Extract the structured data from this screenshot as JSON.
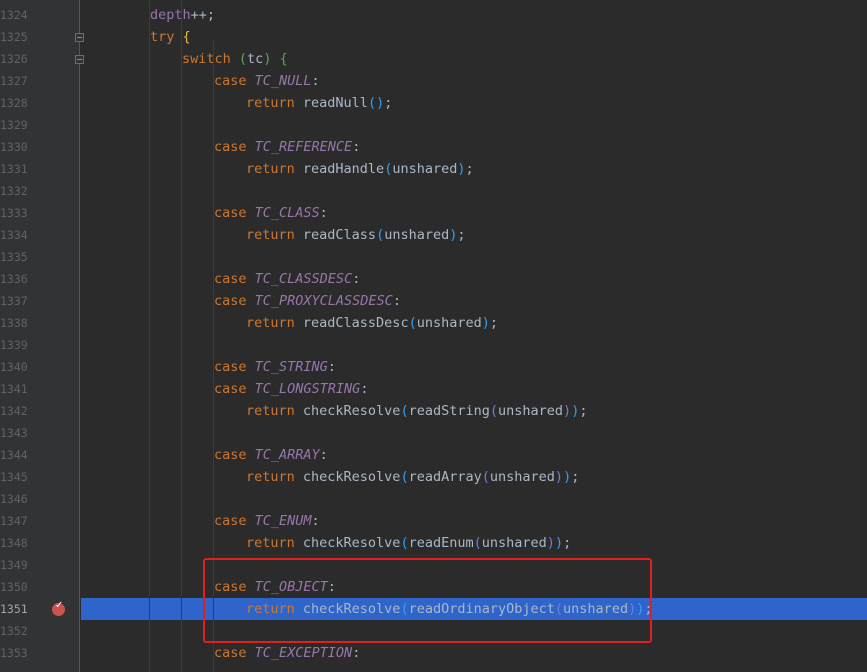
{
  "gutter": {
    "line_numbers": [
      "1324",
      "1325",
      "1326",
      "1327",
      "1328",
      "1329",
      "1330",
      "1331",
      "1332",
      "1333",
      "1334",
      "1335",
      "1336",
      "1337",
      "1338",
      "1339",
      "1340",
      "1341",
      "1342",
      "1343",
      "1344",
      "1345",
      "1346",
      "1347",
      "1348",
      "1349",
      "1350",
      "1351",
      "1352",
      "1353"
    ]
  },
  "editor": {
    "current_line": "1351",
    "lines": [
      [
        [
          "var",
          "depth"
        ],
        [
          "pl",
          "++;"
        ]
      ],
      [
        [
          "kw",
          "try "
        ],
        [
          "p1",
          "{"
        ]
      ],
      [
        [
          "kw",
          "switch "
        ],
        [
          "p2",
          "("
        ],
        [
          "pl",
          "tc"
        ],
        [
          "p2",
          ")"
        ],
        [
          "pl",
          " "
        ],
        [
          "p2",
          "{"
        ]
      ],
      [
        [
          "kw",
          "case "
        ],
        [
          "const",
          "TC_NULL"
        ],
        [
          "pl",
          ":"
        ]
      ],
      [
        [
          "kw",
          "return "
        ],
        [
          "pl",
          "readNull"
        ],
        [
          "p3",
          "()"
        ],
        [
          "pl",
          ";"
        ]
      ],
      [],
      [
        [
          "kw",
          "case "
        ],
        [
          "const",
          "TC_REFERENCE"
        ],
        [
          "pl",
          ":"
        ]
      ],
      [
        [
          "kw",
          "return "
        ],
        [
          "pl",
          "readHandle"
        ],
        [
          "p3",
          "("
        ],
        [
          "pl",
          "unshared"
        ],
        [
          "p3",
          ")"
        ],
        [
          "pl",
          ";"
        ]
      ],
      [],
      [
        [
          "kw",
          "case "
        ],
        [
          "const",
          "TC_CLASS"
        ],
        [
          "pl",
          ":"
        ]
      ],
      [
        [
          "kw",
          "return "
        ],
        [
          "pl",
          "readClass"
        ],
        [
          "p3",
          "("
        ],
        [
          "pl",
          "unshared"
        ],
        [
          "p3",
          ")"
        ],
        [
          "pl",
          ";"
        ]
      ],
      [],
      [
        [
          "kw",
          "case "
        ],
        [
          "const",
          "TC_CLASSDESC"
        ],
        [
          "pl",
          ":"
        ]
      ],
      [
        [
          "kw",
          "case "
        ],
        [
          "const",
          "TC_PROXYCLASSDESC"
        ],
        [
          "pl",
          ":"
        ]
      ],
      [
        [
          "kw",
          "return "
        ],
        [
          "pl",
          "readClassDesc"
        ],
        [
          "p3",
          "("
        ],
        [
          "pl",
          "unshared"
        ],
        [
          "p3",
          ")"
        ],
        [
          "pl",
          ";"
        ]
      ],
      [],
      [
        [
          "kw",
          "case "
        ],
        [
          "const",
          "TC_STRING"
        ],
        [
          "pl",
          ":"
        ]
      ],
      [
        [
          "kw",
          "case "
        ],
        [
          "const",
          "TC_LONGSTRING"
        ],
        [
          "pl",
          ":"
        ]
      ],
      [
        [
          "kw",
          "return "
        ],
        [
          "pl",
          "checkResolve"
        ],
        [
          "p3",
          "("
        ],
        [
          "pl",
          "readString"
        ],
        [
          "p4",
          "("
        ],
        [
          "pl",
          "unshared"
        ],
        [
          "p4",
          ")"
        ],
        [
          "p3",
          ")"
        ],
        [
          "pl",
          ";"
        ]
      ],
      [],
      [
        [
          "kw",
          "case "
        ],
        [
          "const",
          "TC_ARRAY"
        ],
        [
          "pl",
          ":"
        ]
      ],
      [
        [
          "kw",
          "return "
        ],
        [
          "pl",
          "checkResolve"
        ],
        [
          "p3",
          "("
        ],
        [
          "pl",
          "readArray"
        ],
        [
          "p4",
          "("
        ],
        [
          "pl",
          "unshared"
        ],
        [
          "p4",
          ")"
        ],
        [
          "p3",
          ")"
        ],
        [
          "pl",
          ";"
        ]
      ],
      [],
      [
        [
          "kw",
          "case "
        ],
        [
          "const",
          "TC_ENUM"
        ],
        [
          "pl",
          ":"
        ]
      ],
      [
        [
          "kw",
          "return "
        ],
        [
          "pl",
          "checkResolve"
        ],
        [
          "p3",
          "("
        ],
        [
          "pl",
          "readEnum"
        ],
        [
          "p4",
          "("
        ],
        [
          "pl",
          "unshared"
        ],
        [
          "p4",
          ")"
        ],
        [
          "p3",
          ")"
        ],
        [
          "pl",
          ";"
        ]
      ],
      [],
      [
        [
          "kw",
          "case "
        ],
        [
          "const",
          "TC_OBJECT"
        ],
        [
          "pl",
          ":"
        ]
      ],
      [
        [
          "kw",
          "return "
        ],
        [
          "pl",
          "checkResolve"
        ],
        [
          "p3",
          "("
        ],
        [
          "pl",
          "readOrdinaryObject"
        ],
        [
          "p4",
          "("
        ],
        [
          "pl",
          "unshared"
        ],
        [
          "p4",
          ")"
        ],
        [
          "p3",
          ")"
        ],
        [
          "pl",
          ";"
        ]
      ],
      [],
      [
        [
          "kw",
          "case "
        ],
        [
          "const",
          "TC_EXCEPTION"
        ],
        [
          "pl",
          ":"
        ]
      ]
    ]
  },
  "colors": {
    "background": "#2b2b2b",
    "gutter": "#313335",
    "current_line_highlight": "#2f65ca",
    "annotation_box": "#e02020",
    "breakpoint": "#c75450"
  },
  "icons": {
    "breakpoint": "breakpoint-icon",
    "fold": "fold-marker-icon"
  },
  "breakpoint_glyph": "✓"
}
